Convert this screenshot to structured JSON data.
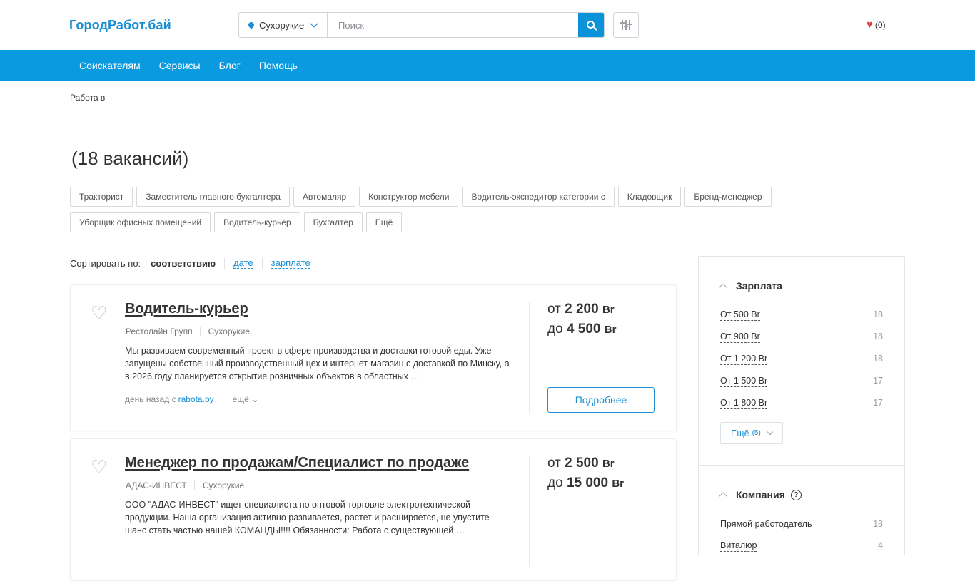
{
  "header": {
    "logo": "ГородРабот.бай",
    "city": "Сухорукие",
    "search_placeholder": "Поиск",
    "favorites_count": "(0)"
  },
  "nav": [
    "Соискателям",
    "Сервисы",
    "Блог",
    "Помощь"
  ],
  "breadcrumb": "Работа в",
  "title": "(18 вакансий)",
  "tags": [
    "Тракторист",
    "Заместитель главного бухгалтера",
    "Автомаляр",
    "Конструктор мебели",
    "Водитель-экспедитор категории с",
    "Кладовщик",
    "Бренд-менеджер",
    "Уборщик офисных помещений",
    "Водитель-курьер",
    "Бухгалтер",
    "Ещё"
  ],
  "sort": {
    "label": "Сортировать по:",
    "current": "соответствию",
    "options": [
      "дате",
      "зарплате"
    ]
  },
  "vacancies": [
    {
      "title": "Водитель-курьер",
      "company": "Рестолайн Групп",
      "city": "Сухорукие",
      "description": "Мы развиваем современный проект в сфере производства и доставки готовой еды. Уже запущены собственный производственный цех и интернет-магазин с доставкой по Минску, а в 2026 году планируется открытие розничных объектов в областных …",
      "posted": "день назад с",
      "source": "rabota.by",
      "more": "ещё",
      "salary_from_prefix": "от",
      "salary_from": "2 200",
      "salary_to_prefix": "до",
      "salary_to": "4 500",
      "currency": "Br",
      "details": "Подробнее"
    },
    {
      "title": "Менеджер по продажам/Специалист по продаже",
      "company": "АДАС-ИНВЕСТ",
      "city": "Сухорукие",
      "description": "ООО \"АДАС-ИНВЕСТ\" ищет специалиста по оптовой торговле электротехнической продукции. Наша организация активно развивается, растет и расширяется, не упустите шанс стать частью нашей КОМАНДЫ!!!! Обязанности: Работа с существующей …",
      "salary_from_prefix": "от",
      "salary_from": "2 500",
      "salary_to_prefix": "до",
      "salary_to": "15 000",
      "currency": "Br"
    }
  ],
  "sidebar": {
    "salary_title": "Зарплата",
    "salary_items": [
      {
        "label": "От 500 Br",
        "count": "18"
      },
      {
        "label": "От 900 Br",
        "count": "18"
      },
      {
        "label": "От 1 200 Br",
        "count": "18"
      },
      {
        "label": "От 1 500 Br",
        "count": "17"
      },
      {
        "label": "От 1 800 Br",
        "count": "17"
      }
    ],
    "more_label": "Ещё",
    "more_count": "(5)",
    "company_title": "Компания",
    "company_items": [
      {
        "label": "Прямой работодатель",
        "count": "18"
      },
      {
        "label": "Виталюр",
        "count": "4"
      }
    ]
  }
}
